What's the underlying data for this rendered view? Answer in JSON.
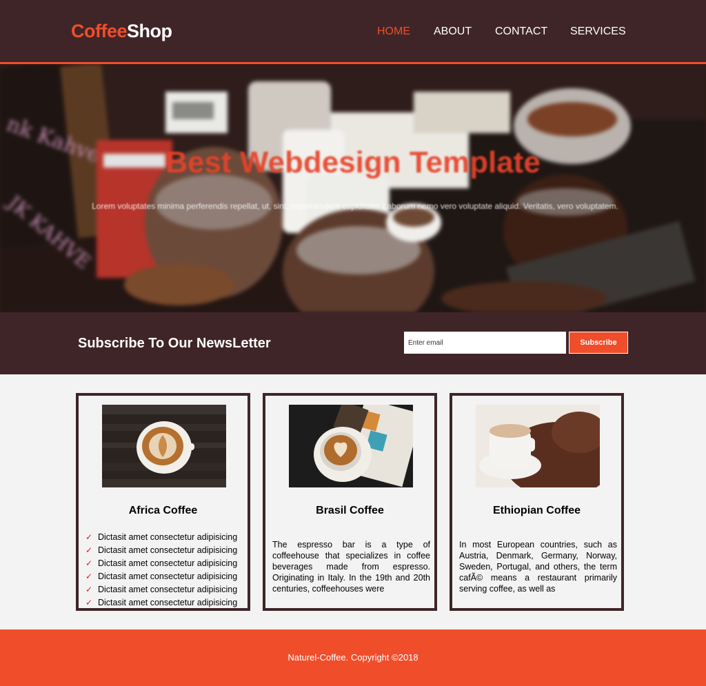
{
  "header": {
    "logo_part1": "Coffee",
    "logo_part2": "Shop",
    "nav": [
      {
        "label": "HOME",
        "active": true
      },
      {
        "label": "ABOUT",
        "active": false
      },
      {
        "label": "CONTACT",
        "active": false
      },
      {
        "label": "SERVICES",
        "active": false
      }
    ]
  },
  "hero": {
    "title": "Best Webdesign Template",
    "text": "Lorem voluptates minima perferendis repellat, ut, sint, reprehenderit cupiditate! Laborum nemo vero voluptate aliquid. Veritatis, vero voluptatem."
  },
  "newsletter": {
    "title": "Subscribe To Our NewsLetter",
    "placeholder": "Enter email",
    "button": "Subscribe"
  },
  "cards": [
    {
      "title": "Africa Coffee",
      "check": "✓",
      "items": [
        "Dictasit amet consectetur adipisicing",
        "Dictasit amet consectetur adipisicing",
        "Dictasit amet consectetur adipisicing",
        "Dictasit amet consectetur adipisicing",
        "Dictasit amet consectetur adipisicing",
        "Dictasit amet consectetur adipisicing"
      ]
    },
    {
      "title": "Brasil Coffee",
      "text": "The espresso bar is a type of coffeehouse that specializes in coffee beverages made from espresso. Originating in Italy. In the 19th and 20th centuries, coffeehouses were"
    },
    {
      "title": "Ethiopian Coffee",
      "text": "In most European countries, such as Austria, Denmark, Germany, Norway, Sweden, Portugal, and others, the term cafÃ© means a restaurant primarily serving coffee, as well as"
    }
  ],
  "footer": {
    "text": "Naturel-Coffee. Copyright ©2018"
  },
  "colors": {
    "brand": "#f04e2b",
    "dark": "#3f2528",
    "background": "#f3f3f3",
    "check": "#e0141e"
  }
}
